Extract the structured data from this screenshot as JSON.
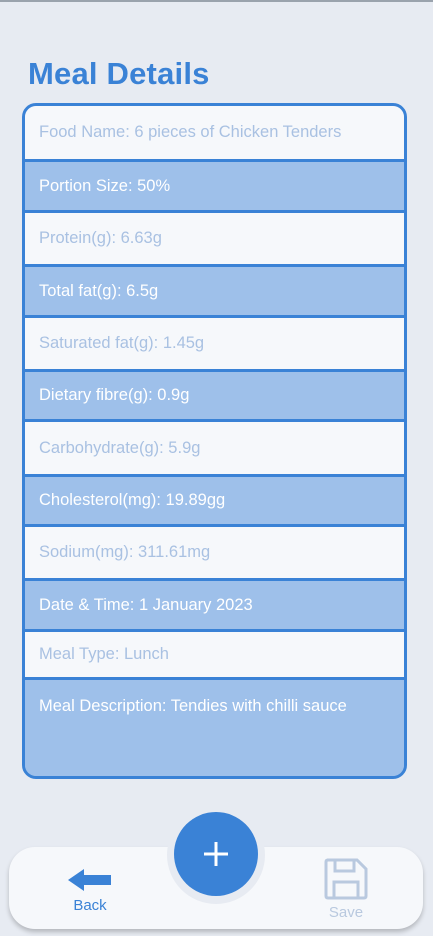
{
  "page": {
    "title": "Meal Details"
  },
  "meal": {
    "fields": [
      "Food Name: 6 pieces of Chicken Tenders",
      "Portion Size: 50%",
      "Protein(g): 6.63g",
      "Total fat(g): 6.5g",
      "Saturated fat(g): 1.45g",
      "Dietary fibre(g): 0.9g",
      "Carbohydrate(g): 5.9g",
      "Cholesterol(mg): 19.89gg",
      "Sodium(mg): 311.61mg",
      "Date & Time: 1 January 2023",
      "Meal Type: Lunch",
      "Meal Description: Tendies with chilli sauce"
    ]
  },
  "nav": {
    "back_label": "Back",
    "save_label": "Save",
    "add_icon": "plus-icon",
    "back_icon": "arrow-left-icon",
    "save_icon": "floppy-disk-icon"
  },
  "colors": {
    "accent": "#3a82d6",
    "row_light": "#f6f8fb",
    "row_dark": "#9ec0ea",
    "background": "#e7ebf2"
  }
}
